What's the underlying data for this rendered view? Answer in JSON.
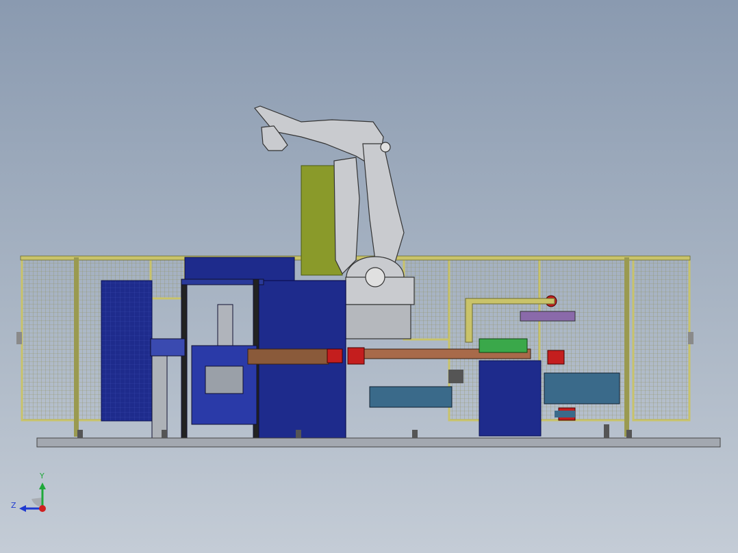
{
  "viewport": {
    "colors": {
      "bg_top": "#8a9ab0",
      "bg_bottom": "#c4ccd6",
      "fence_frame": "#c9c36a",
      "fence_mesh": "#9a9a60",
      "base_plate": "#a3a8b0",
      "blue_cabinet": "#1e2b8c",
      "olive_panel": "#8a9a2a",
      "robot": "#c9cbcf",
      "brown_beam": "#8a5a3a",
      "red_motor": "#c41e1e",
      "green_part": "#3aa84a",
      "teal_part": "#3a6a8a"
    }
  },
  "triad": {
    "y_label": "Y",
    "z_label": "Z",
    "y_color": "#1fa83a",
    "z_color": "#1f3ad0",
    "x_color": "#d01f1f"
  }
}
